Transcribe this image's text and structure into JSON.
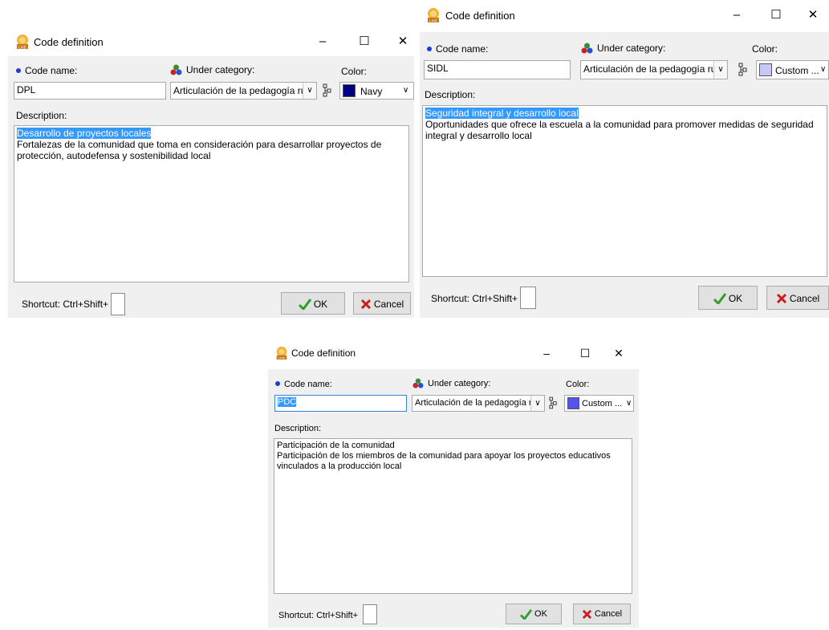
{
  "dialogs": [
    {
      "title": "Code definition",
      "code_name_label": "Code name:",
      "code_name_value": "DPL",
      "under_category_label": "Under category:",
      "under_category_value": "Articulación de la pedagogía ru",
      "color_label": "Color:",
      "color_value": "Navy",
      "color_swatch": "#000080",
      "description_label": "Description:",
      "description_title": "Desarrollo de proyectos locales",
      "description_body": "Fortalezas de la comunidad que toma en consideración para desarrollar proyectos de protección, autodefensa y sostenibilidad local",
      "shortcut_label": "Shortcut: Ctrl+Shift+",
      "ok_label": "OK",
      "cancel_label": "Cancel"
    },
    {
      "title": "Code definition",
      "code_name_label": "Code name:",
      "code_name_value": "SIDL",
      "under_category_label": "Under category:",
      "under_category_value": "Articulación de la pedagogía ru",
      "color_label": "Color:",
      "color_value": "Custom ...",
      "color_swatch": "#c8c8f8",
      "description_label": "Description:",
      "description_title": "Seguridad integral y desarrollo local",
      "description_body": "Oportunidades que ofrece la escuela a la comunidad para promover medidas de seguridad integral y desarrollo local",
      "shortcut_label": "Shortcut: Ctrl+Shift+",
      "ok_label": "OK",
      "cancel_label": "Cancel"
    },
    {
      "title": "Code definition",
      "code_name_label": "Code name:",
      "code_name_value": "PDC",
      "under_category_label": "Under category:",
      "under_category_value": "Articulación de la pedagogía ru",
      "color_label": "Color:",
      "color_value": "Custom ...",
      "color_swatch": "#5555ee",
      "description_label": "Description:",
      "description_title": "Participación de la comunidad",
      "description_body": "Participación de los miembros de la comunidad para apoyar los proyectos educativos vinculados a la producción local",
      "shortcut_label": "Shortcut: Ctrl+Shift+",
      "ok_label": "OK",
      "cancel_label": "Cancel"
    }
  ],
  "icons": {
    "app": "app-logo-icon",
    "minimize": "minimize-icon",
    "maximize": "maximize-icon",
    "close": "close-icon",
    "category": "category-icon",
    "tree": "tree-icon",
    "ok": "checkmark-icon",
    "cancel": "cancel-x-icon"
  },
  "colors": {
    "dialog_bg": "#f0f0f0",
    "selection": "#3399ff",
    "ok_check": "#2e9d2e",
    "cancel_x": "#c81e1e",
    "required_dot": "#1a3fd0"
  }
}
